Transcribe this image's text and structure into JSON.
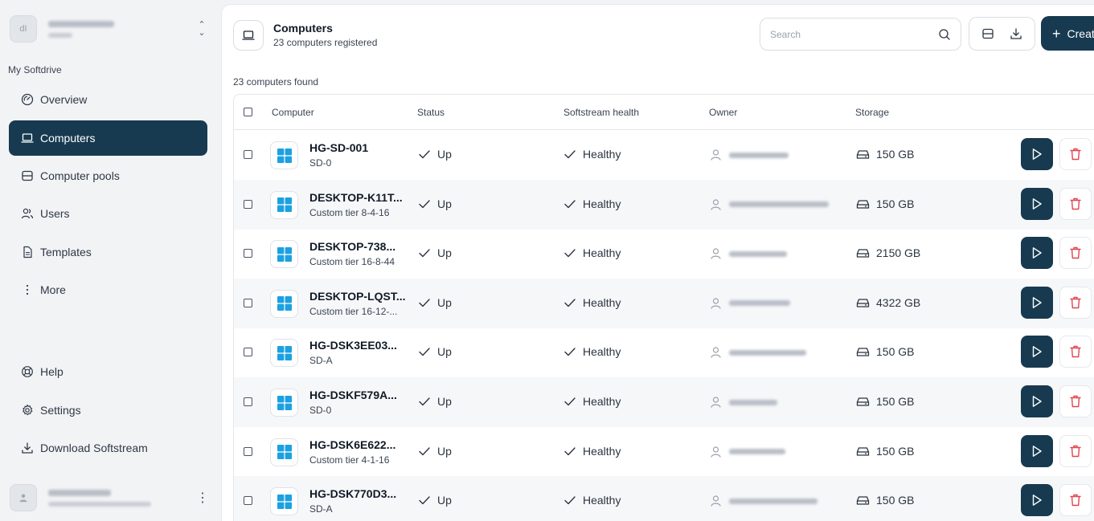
{
  "sidebar": {
    "org_avatar_initial": "dI",
    "section_label": "My Softdrive",
    "items": [
      {
        "key": "overview",
        "label": "Overview",
        "icon": "gauge-icon"
      },
      {
        "key": "computers",
        "label": "Computers",
        "icon": "laptop-icon",
        "active": true
      },
      {
        "key": "computer-pools",
        "label": "Computer pools",
        "icon": "server-icon"
      },
      {
        "key": "users",
        "label": "Users",
        "icon": "users-icon"
      },
      {
        "key": "templates",
        "label": "Templates",
        "icon": "document-icon"
      },
      {
        "key": "more",
        "label": "More",
        "icon": "more-vertical-icon"
      }
    ],
    "bottom_items": [
      {
        "key": "help",
        "label": "Help",
        "icon": "lifebuoy-icon"
      },
      {
        "key": "settings",
        "label": "Settings",
        "icon": "gear-icon"
      },
      {
        "key": "download",
        "label": "Download Softstream",
        "icon": "download-icon"
      }
    ]
  },
  "header": {
    "title": "Computers",
    "subtitle": "23 computers registered",
    "search_placeholder": "Search",
    "create_label": "Creat"
  },
  "results_text": "23 computers found",
  "table": {
    "columns": [
      "Computer",
      "Status",
      "Softstream health",
      "Owner",
      "Storage"
    ],
    "rows": [
      {
        "name": "HG-SD-001",
        "tier": "SD-0",
        "status": "Up",
        "health": "Healthy",
        "storage": "150 GB"
      },
      {
        "name": "DESKTOP-K11T...",
        "tier": "Custom tier 8-4-16",
        "status": "Up",
        "health": "Healthy",
        "storage": "150 GB"
      },
      {
        "name": "DESKTOP-738...",
        "tier": "Custom tier 16-8-44",
        "status": "Up",
        "health": "Healthy",
        "storage": "2150 GB"
      },
      {
        "name": "DESKTOP-LQST...",
        "tier": "Custom tier 16-12-...",
        "status": "Up",
        "health": "Healthy",
        "storage": "4322 GB"
      },
      {
        "name": "HG-DSK3EE03...",
        "tier": "SD-A",
        "status": "Up",
        "health": "Healthy",
        "storage": "150 GB"
      },
      {
        "name": "HG-DSKF579A...",
        "tier": "SD-0",
        "status": "Up",
        "health": "Healthy",
        "storage": "150 GB"
      },
      {
        "name": "HG-DSK6E622...",
        "tier": "Custom tier 4-1-16",
        "status": "Up",
        "health": "Healthy",
        "storage": "150 GB"
      },
      {
        "name": "HG-DSK770D3...",
        "tier": "SD-A",
        "status": "Up",
        "health": "Healthy",
        "storage": "150 GB"
      }
    ]
  },
  "colors": {
    "primary": "#173a50",
    "danger": "#e0454f",
    "windows_blue": "#1ba1e2"
  }
}
